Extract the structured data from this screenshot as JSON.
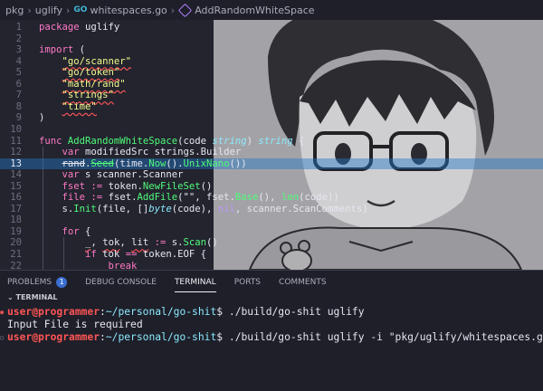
{
  "breadcrumb": {
    "parts": [
      "pkg",
      "uglify",
      "whitespaces.go",
      "AddRandomWhiteSpace"
    ],
    "go_badge": "GO"
  },
  "editor": {
    "line_numbers": [
      "1",
      "2",
      "3",
      "4",
      "5",
      "6",
      "7",
      "8",
      "9",
      "10",
      "11",
      "12",
      "13",
      "14",
      "15",
      "16",
      "17",
      "18",
      "19",
      "20",
      "21",
      "22"
    ],
    "current_line": "13",
    "code": {
      "l1": [
        "package",
        "uglify"
      ],
      "l3": [
        "import",
        "("
      ],
      "l4": "\"go/scanner\"",
      "l5": "\"go/token\"",
      "l6": "\"math/rand\"",
      "l7": "\"strings\"",
      "l8": "\"time\"",
      "l9": ")",
      "l11": [
        "func",
        "AddRandomWhiteSpace",
        "(code ",
        "string",
        ") ",
        "string",
        " {"
      ],
      "l12": [
        "var",
        " modifiedSrc strings.Builder"
      ],
      "l13": [
        "rand",
        ".",
        "Seed",
        "(time.",
        "Now",
        "().",
        "UnixNano",
        "())"
      ],
      "l14": [
        "var",
        " s scanner.Scanner"
      ],
      "l15": [
        "fset",
        " ",
        ":=",
        " token.",
        "NewFileSet",
        "()"
      ],
      "l16": [
        "file",
        " ",
        ":=",
        " fset.",
        "AddFile",
        "(\"\", fset.",
        "Base",
        "(), ",
        "len",
        "(code))"
      ],
      "l17": [
        "s.",
        "Init",
        "(file, []",
        "byte",
        "(code), ",
        "nil",
        ", scanner.ScanComments)"
      ],
      "l19": [
        "for",
        " {"
      ],
      "l20": [
        "_",
        ", ",
        "tok",
        ", ",
        "lit",
        " ",
        ":=",
        " s.",
        "Scan",
        "()"
      ],
      "l21": [
        "if",
        " tok ",
        "==",
        " token.EOF {"
      ],
      "l22": "break"
    }
  },
  "panel": {
    "tabs": [
      "PROBLEMS",
      "DEBUG CONSOLE",
      "TERMINAL",
      "PORTS",
      "COMMENTS"
    ],
    "active_tab": "TERMINAL",
    "problems_count": "1",
    "section_title": "TERMINAL"
  },
  "terminal": {
    "prompt_user": "user@programmer",
    "prompt_sep": ":",
    "prompt_path": "~/personal/go-shit",
    "prompt_end": "$ ",
    "cmd1": "./build/go-shit uglify",
    "output1": "Input File is required",
    "cmd2": "./build/go-shit uglify -i \"pkg/uglify/whitespaces.go"
  },
  "colors": {
    "keyword": "#ff79c6",
    "function": "#50fa7b",
    "string": "#f1fa8c",
    "type": "#8be9fd",
    "prompt_user": "#ff5555",
    "prompt_path": "#8be9fd",
    "line_highlight": "#2478c8"
  }
}
